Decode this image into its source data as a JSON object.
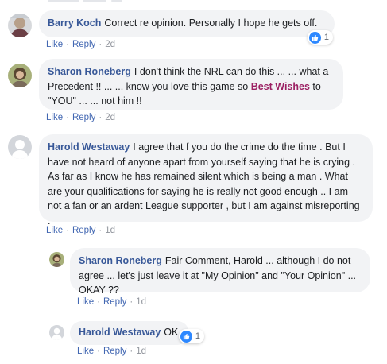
{
  "comments": [
    {
      "author": "Barry Koch",
      "text": "Correct re opinion. Personally I hope he gets off.",
      "like_label": "Like",
      "reply_label": "Reply",
      "time": "2d",
      "reactions": {
        "icon": "thumbs-up-icon",
        "count": "1"
      }
    },
    {
      "author": "Sharon Roneberg",
      "text_before": "I don't think the NRL can do this ... ... what a Precedent !! ... ... know you love this game so ",
      "highlight": "Best Wishes",
      "text_after": " to \"YOU\" ... ... not him !!",
      "like_label": "Like",
      "reply_label": "Reply",
      "time": "2d"
    },
    {
      "author": "Harold Westaway",
      "text": "I agree that f you do the crime do the time . But I have not heard of anyone apart from yourself saying that he is crying . As far as I know he has remained silent which is being a man . What are your qualifications for saying he is really not good enough .. I am not a fan or an ardent League supporter , but I am against misreporting .",
      "like_label": "Like",
      "reply_label": "Reply",
      "time": "1d",
      "replies": [
        {
          "author": "Sharon Roneberg",
          "text": "Fair Comment, Harold ... although I do not agree ... let's just leave it at \"My Opinion\" and \"Your Opinion\" ... OKAY ??",
          "like_label": "Like",
          "reply_label": "Reply",
          "time": "1d"
        },
        {
          "author": "Harold Westaway",
          "text": "OK",
          "like_label": "Like",
          "reply_label": "Reply",
          "time": "1d",
          "reactions": {
            "icon": "thumbs-up-icon",
            "count": "1"
          }
        }
      ]
    }
  ],
  "separator": "·",
  "colors": {
    "author": "#385898",
    "link": "#4267b2",
    "highlight": "#9c2163",
    "bubble": "#f2f3f5",
    "like_badge": "#2d88ff"
  }
}
